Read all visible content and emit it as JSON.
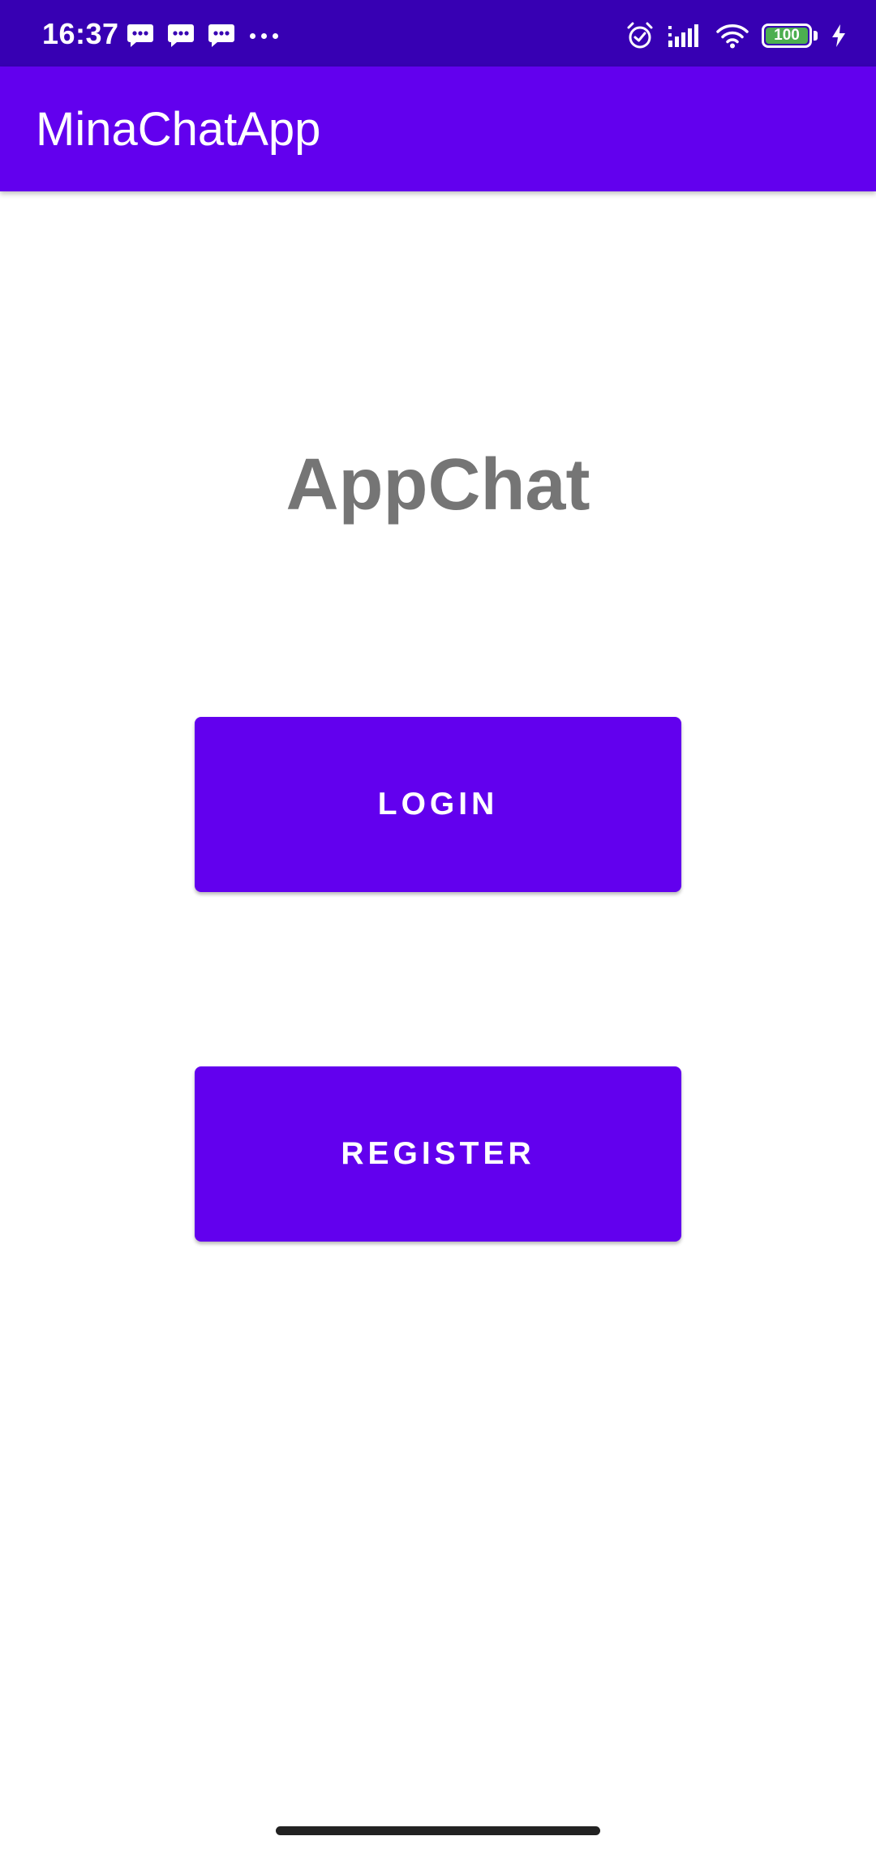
{
  "status_bar": {
    "time": "16:37",
    "battery_level": "100",
    "notification_icons": [
      "message-icon",
      "message-icon",
      "message-icon",
      "more-dots-icon"
    ],
    "system_icons": [
      "alarm-icon",
      "cellular-signal-icon",
      "wifi-icon",
      "battery-icon",
      "charging-bolt-icon"
    ]
  },
  "app_bar": {
    "title": "MinaChatApp"
  },
  "main": {
    "heading": "AppChat",
    "login_label": "LOGIN",
    "register_label": "REGISTER"
  },
  "colors": {
    "status_bar": "#3700b3",
    "primary": "#6200ee",
    "heading_text": "#757575",
    "battery_fill": "#4caf50"
  }
}
